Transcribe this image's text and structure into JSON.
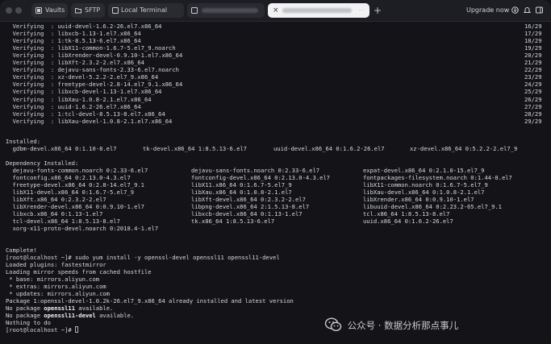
{
  "tabs": {
    "vaults": "Vaults",
    "sftp": "SFTP",
    "local": "Local Terminal"
  },
  "titlebar": {
    "upgrade": "Upgrade now"
  },
  "verifying": [
    {
      "text": "  Verifying  : uuid-devel-1.6.2-26.el7.x86_64",
      "ratio": "16/29"
    },
    {
      "text": "  Verifying  : libxcb-1.13-1.el7.x86_64",
      "ratio": "17/29"
    },
    {
      "text": "  Verifying  : 1:tk-8.5.13-6.el7.x86_64",
      "ratio": "18/29"
    },
    {
      "text": "  Verifying  : libX11-common-1.6.7-5.el7_9.noarch",
      "ratio": "19/29"
    },
    {
      "text": "  Verifying  : libXrender-devel-0.9.10-1.el7.x86_64",
      "ratio": "20/29"
    },
    {
      "text": "  Verifying  : libXft-2.3.2-2.el7.x86_64",
      "ratio": "21/29"
    },
    {
      "text": "  Verifying  : dejavu-sans-fonts-2.33-6.el7.noarch",
      "ratio": "22/29"
    },
    {
      "text": "  Verifying  : xz-devel-5.2.2-2.el7_9.x86_64",
      "ratio": "23/29"
    },
    {
      "text": "  Verifying  : freetype-devel-2.8-14.el7_9.1.x86_64",
      "ratio": "24/29"
    },
    {
      "text": "  Verifying  : libxcb-devel-1.13-1.el7.x86_64",
      "ratio": "25/29"
    },
    {
      "text": "  Verifying  : libXau-1.0.8-2.1.el7.x86_64",
      "ratio": "26/29"
    },
    {
      "text": "  Verifying  : uuid-1.6.2-26.el7.x86_64",
      "ratio": "27/29"
    },
    {
      "text": "  Verifying  : 1:tcl-devel-8.5.13-8.el7.x86_64",
      "ratio": "28/29"
    },
    {
      "text": "  Verifying  : libXau-devel-1.0.8-2.1.el7.x86_64",
      "ratio": "29/29"
    }
  ],
  "installed": {
    "header": "Installed:",
    "items": [
      "  gdbm-devel.x86_64 0:1.10-8.el7",
      "tk-devel.x86_64 1:8.5.13-6.el7",
      "uuid-devel.x86_64 0:1.6.2-26.el7",
      "xz-devel.x86_64 0:5.2.2-2.el7_9"
    ]
  },
  "dependency": {
    "header": "Dependency Installed:",
    "rows": [
      [
        "  dejavu-fonts-common.noarch 0:2.33-6.el7",
        "dejavu-sans-fonts.noarch 0:2.33-6.el7",
        "expat-devel.x86_64 0:2.1.0-15.el7_9"
      ],
      [
        "  fontconfig.x86_64 0:2.13.0-4.3.el7",
        "fontconfig-devel.x86_64 0:2.13.0-4.3.el7",
        "fontpackages-filesystem.noarch 0:1.44-8.el7"
      ],
      [
        "  freetype-devel.x86_64 0:2.8-14.el7_9.1",
        "libX11.x86_64 0:1.6.7-5.el7_9",
        "libX11-common.noarch 0:1.6.7-5.el7_9"
      ],
      [
        "  libX11-devel.x86_64 0:1.6.7-5.el7_9",
        "libXau.x86_64 0:1.0.8-2.1.el7",
        "libXau-devel.x86_64 0:1.0.8-2.1.el7"
      ],
      [
        "  libXft.x86_64 0:2.3.2-2.el7",
        "libXft-devel.x86_64 0:2.3.2-2.el7",
        "libXrender.x86_64 0:0.9.10-1.el7"
      ],
      [
        "  libXrender-devel.x86_64 0:0.9.10-1.el7",
        "libpng-devel.x86_64 2:1.5.13-8.el7",
        "libuuid-devel.x86_64 0:2.23.2-65.el7_9.1"
      ],
      [
        "  libxcb.x86_64 0:1.13-1.el7",
        "libxcb-devel.x86_64 0:1.13-1.el7",
        "tcl.x86_64 1:8.5.13-8.el7"
      ],
      [
        "  tcl-devel.x86_64 1:8.5.13-8.el7",
        "tk.x86_64 1:8.5.13-6.el7",
        "uuid.x86_64 0:1.6.2-26.el7"
      ],
      [
        "  xorg-x11-proto-devel.noarch 0:2018.4-1.el7",
        "",
        ""
      ]
    ]
  },
  "tail": {
    "complete": "Complete!",
    "prompt1": "[root@localhost ~]# sudo yum install -y openssl-devel openssl11 openssl11-devel",
    "plugins": "Loaded plugins: fastestmirror",
    "loading": "Loading mirror speeds from cached hostfile",
    "base": " * base: mirrors.aliyun.com",
    "extras": " * extras: mirrors.aliyun.com",
    "updates": " * updates: mirrors.aliyun.com",
    "already": "Package 1:openssl-devel-1.0.2k-26.el7_9.x86_64 already installed and latest version",
    "nopkg1_prefix": "No package ",
    "nopkg1_name": "openssl11",
    "nopkg1_suffix": " available.",
    "nopkg2_prefix": "No package ",
    "nopkg2_name": "openssl11-devel",
    "nopkg2_suffix": " available.",
    "nothing": "Nothing to do",
    "prompt2": "[root@localhost ~]# "
  },
  "watermark": {
    "text": "公众号 · 数据分析那点事儿"
  }
}
